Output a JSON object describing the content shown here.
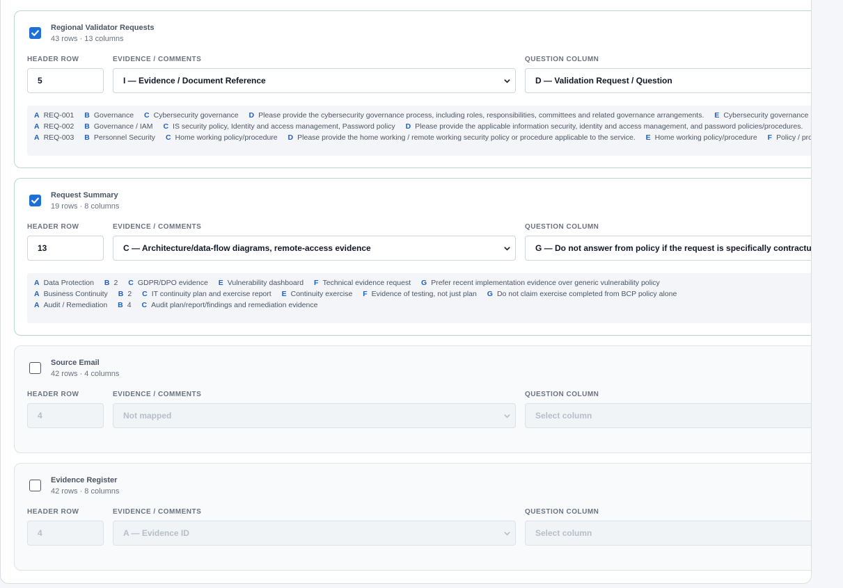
{
  "labels": {
    "header_row": "HEADER ROW",
    "evidence": "EVIDENCE / COMMENTS",
    "question": "QUESTION COLUMN"
  },
  "sheets": [
    {
      "title": "Regional Validator Requests",
      "meta": "43 rows · 13 columns",
      "checked": true,
      "header_row": "5",
      "evidence": "I — Evidence / Document Reference",
      "question": "D — Validation Request / Question",
      "preview": [
        [
          [
            "A",
            "REQ-001"
          ],
          [
            "B",
            "Governance"
          ],
          [
            "C",
            "Cybersecurity governance"
          ],
          [
            "D",
            "Please provide the cybersecurity governance process, including roles, responsibilities, committees and related governance arrangements."
          ],
          [
            "E",
            "Cybersecurity governance"
          ]
        ],
        [
          [
            "A",
            "REQ-002"
          ],
          [
            "B",
            "Governance / IAM"
          ],
          [
            "C",
            "IS security policy, Identity and access management, Password policy"
          ],
          [
            "D",
            "Please provide the applicable information security, identity and access management, and password policies/procedures."
          ]
        ],
        [
          [
            "A",
            "REQ-003"
          ],
          [
            "B",
            "Personnel Security"
          ],
          [
            "C",
            "Home working policy/procedure"
          ],
          [
            "D",
            "Please provide the home working / remote working security policy or procedure applicable to the service."
          ],
          [
            "E",
            "Home working policy/procedure"
          ],
          [
            "F",
            "Policy / procedure"
          ]
        ]
      ]
    },
    {
      "title": "Request Summary",
      "meta": "19 rows · 8 columns",
      "checked": true,
      "header_row": "13",
      "evidence": "C — Architecture/data-flow diagrams, remote-access evidence",
      "question": "G — Do not answer from policy if the request is specifically contractual",
      "preview": [
        [
          [
            "A",
            "Data Protection"
          ],
          [
            "B",
            "2"
          ],
          [
            "C",
            "GDPR/DPO evidence"
          ],
          [
            "E",
            "Vulnerability dashboard"
          ],
          [
            "F",
            "Technical evidence request"
          ],
          [
            "G",
            "Prefer recent implementation evidence over generic vulnerability policy"
          ]
        ],
        [
          [
            "A",
            "Business Continuity"
          ],
          [
            "B",
            "2"
          ],
          [
            "C",
            "IT continuity plan and exercise report"
          ],
          [
            "E",
            "Continuity exercise"
          ],
          [
            "F",
            "Evidence of testing, not just plan"
          ],
          [
            "G",
            "Do not claim exercise completed from BCP policy alone"
          ]
        ],
        [
          [
            "A",
            "Audit / Remediation"
          ],
          [
            "B",
            "4"
          ],
          [
            "C",
            "Audit plan/report/findings and remediation evidence"
          ]
        ]
      ]
    },
    {
      "title": "Source Email",
      "meta": "42 rows · 4 columns",
      "checked": false,
      "header_row": "4",
      "evidence": "Not mapped",
      "question": "Select column",
      "preview": []
    },
    {
      "title": "Evidence Register",
      "meta": "42 rows · 8 columns",
      "checked": false,
      "header_row": "4",
      "evidence": "A — Evidence ID",
      "question": "Select column",
      "preview": []
    }
  ]
}
